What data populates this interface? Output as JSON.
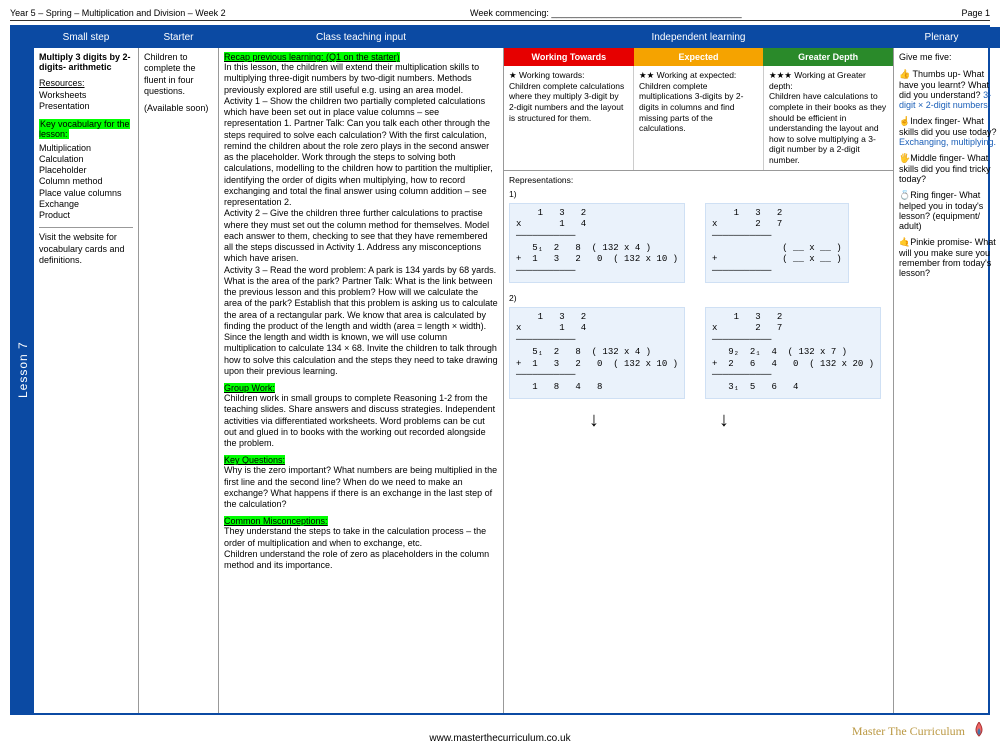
{
  "meta": {
    "title_left": "Year 5 – Spring – Multiplication and Division – Week 2",
    "title_mid": "Week commencing: ______________________________________",
    "page_label": "Page 1",
    "footer": "www.masterthecurriculum.co.uk",
    "logo_text": "Master The Curriculum",
    "lesson_tab": "Lesson 7"
  },
  "headers": {
    "small_step": "Small step",
    "starter": "Starter",
    "teaching": "Class teaching input",
    "independent": "Independent learning",
    "plenary": "Plenary"
  },
  "small_step": {
    "title": "Multiply 3 digits by 2-digits- arithmetic",
    "resources_label": "Resources:",
    "resources": "Worksheets\nPresentation",
    "vocab_label": "Key vocabulary for the lesson:",
    "vocab": "Multiplication\nCalculation\nPlaceholder\nColumn method\nPlace value columns\nExchange\nProduct",
    "note": "Visit the website for vocabulary cards and definitions."
  },
  "starter": {
    "text": "Children to complete the fluent in four questions.",
    "note": "(Available soon)"
  },
  "teaching": {
    "recap_label": "Recap previous learning: (Q1 on the starter)",
    "main": "In this lesson, the children will extend their multiplication skills to multiplying three-digit numbers by two-digit numbers. Methods previously explored are still useful e.g. using an area model.\nActivity 1 – Show the children two partially completed calculations which have been set out in place value columns – see representation 1. Partner Talk: Can you talk each other through the steps required to solve each calculation? With the first calculation, remind the children about the role zero plays in the second answer as the placeholder. Work through the steps to solving both calculations, modelling to the children how to partition the multiplier, identifying the order of digits when multiplying, how to record exchanging and total the final answer using column addition – see representation 2.\nActivity 2 – Give the children three further calculations to practise where they must set out the column method for themselves. Model each answer to them, checking to see that they have remembered all the steps discussed in Activity 1. Address any misconceptions which have arisen.\nActivity 3 – Read the word problem: A park is 134 yards by 68 yards. What is the area of the park? Partner Talk: What is the link between the previous lesson and this problem? How will we calculate the area of the park? Establish that this problem is asking us to calculate the area of a rectangular park. We know that area is calculated by finding the product of the length and width (area = length × width). Since the length and width is known, we will use column multiplication to calculate 134 × 68. Invite the children to talk through how to solve this calculation and the steps they need to take drawing upon their previous learning.",
    "group_label": "Group Work:",
    "group": "Children work in small groups to complete Reasoning 1-2 from the teaching slides. Share answers and discuss strategies. Independent activities via differentiated worksheets. Word problems can be cut out and glued in to books with the working out recorded alongside the problem.",
    "keyq_label": "Key Questions:",
    "keyq": "Why is the zero important? What numbers are being multiplied in the first line and the second line? When do we need to make an exchange? What happens if there is an exchange in the last step of the calculation?",
    "misc_label": "Common Misconceptions:",
    "misc": "They understand the steps to take in the calculation process – the order of multiplication and when to exchange, etc.\nChildren understand the role of zero as placeholders in the column method and its importance."
  },
  "independent": {
    "diff": {
      "wt_head": "Working Towards",
      "ex_head": "Expected",
      "gd_head": "Greater Depth",
      "wt": "★ Working towards:\nChildren complete calculations where they multiply 3-digit by 2-digit numbers and the layout is structured for them.",
      "ex": "★★ Working at expected:\nChildren complete multiplications 3-digits by 2-digits in columns and find missing parts of the calculations.",
      "gd": "★★★ Working at Greater depth:\nChildren have calculations to complete in their books as they should be efficient in understanding the layout and how to solve multiplying a 3-digit number by a 2-digit number."
    },
    "rep_label": "Representations:",
    "rep1_label": "1)",
    "rep1a": "    1   3   2\nx       1   4\n───────────\n   5₁  2   8  ( 132 x 4 )\n+  1   3   2   0  ( 132 x 10 )\n───────────",
    "rep1b": "    1   3   2\nx       2   7\n───────────\n             ( __ x __ )\n+            ( __ x __ )\n───────────",
    "rep2_label": "2)",
    "rep2a": "    1   3   2\nx       1   4\n───────────\n   5₁  2   8  ( 132 x 4 )\n+  1   3   2   0  ( 132 x 10 )\n───────────\n   1   8   4   8",
    "rep2b": "    1   3   2\nx       2   7\n───────────\n   9₂  2₁  4  ( 132 x 7 )\n+  2   6   4   0  ( 132 x 20 )\n───────────\n   3₁  5   6   4",
    "arrow": "↓"
  },
  "plenary": {
    "intro": "Give me five:",
    "thumbs": "👍 Thumbs up- What have you learnt? What did you understand?",
    "thumbs_ans": "3-digit × 2-digit numbers.",
    "index": "☝Index finger- What skills did you use today?",
    "index_ans": "Exchanging, multiplying.",
    "middle": "🖐Middle finger- What skills did you find tricky today?",
    "ring": "💍Ring finger- What helped you in today's lesson? (equipment/ adult)",
    "pinkie": "🤙Pinkie promise- What will you make sure you remember from today's lesson?"
  }
}
